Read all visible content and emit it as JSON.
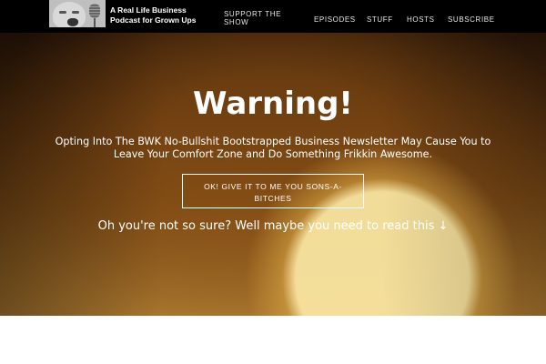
{
  "header": {
    "logo_icon": "crying-baby-microphone-logo",
    "tagline": "A Real Life Business Podcast for Grown Ups",
    "nav": {
      "support": "SUPPORT THE SHOW",
      "episodes": "EPISODES",
      "stuff": "STUFF",
      "hosts": "HOSTS",
      "subscribe": "SUBSCRIBE"
    }
  },
  "hero": {
    "heading": "Warning!",
    "subtext": "Opting Into The BWK No-Bullshit Bootstrapped Business Newsletter May Cause You to Leave Your Comfort Zone and Do Something Frikkin Awesome.",
    "cta_label": "OK! GIVE IT TO ME YOU SONS-A-BITCHES",
    "read_more": "Oh you're not so sure? Well maybe you need to read this ↓"
  },
  "colors": {
    "navbar_bg": "#000000",
    "text": "#ffffff"
  }
}
